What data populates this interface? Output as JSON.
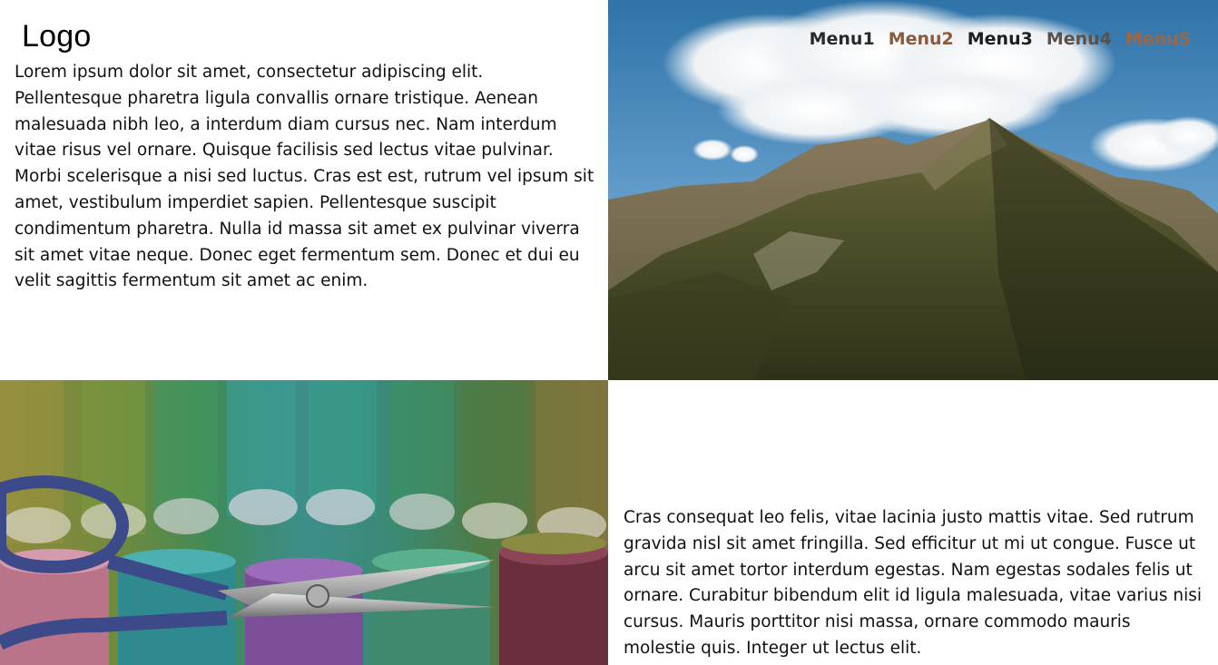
{
  "header": {
    "logo": "Logo"
  },
  "nav": {
    "items": [
      {
        "label": "Menu1",
        "color": "#2a2a2a"
      },
      {
        "label": "Menu2",
        "color": "#8a5a3c"
      },
      {
        "label": "Menu3",
        "color": "#1e1e1e"
      },
      {
        "label": "Menu4",
        "color": "#5e5048"
      },
      {
        "label": "Menu5",
        "color": "#9a6848"
      }
    ]
  },
  "sections": {
    "intro_text": "Lorem ipsum dolor sit amet, consectetur adipiscing elit. Pellentesque pharetra ligula convallis ornare tristique. Aenean malesuada nibh leo, a interdum diam cursus nec. Nam interdum vitae risus vel ornare. Quisque facilisis sed lectus vitae pulvinar. Morbi scelerisque a nisi sed luctus. Cras est est, rutrum vel ipsum sit amet, vestibulum imperdiet sapien. Pellentesque suscipit condimentum pharetra. Nulla id massa sit amet ex pulvinar viverra sit amet vitae neque. Donec eget fermentum sem. Donec et dui eu velit sagittis fermentum sit amet ac enim.",
    "second_text": "Cras consequat leo felis, vitae lacinia justo mattis vitae. Sed rutrum gravida nisl sit amet fringilla. Sed efficitur ut mi ut congue. Fusce ut arcu sit amet tortor interdum egestas. Nam egestas sodales felis ut ornare. Curabitur bibendum elit id ligula malesuada, vitae varius nisi cursus. Mauris porttitor nisi massa, ornare commodo mauris molestie quis. Integer ut lectus elit."
  },
  "images": {
    "hero": "mountain-photo",
    "secondary": "sewing-scissors-photo"
  }
}
